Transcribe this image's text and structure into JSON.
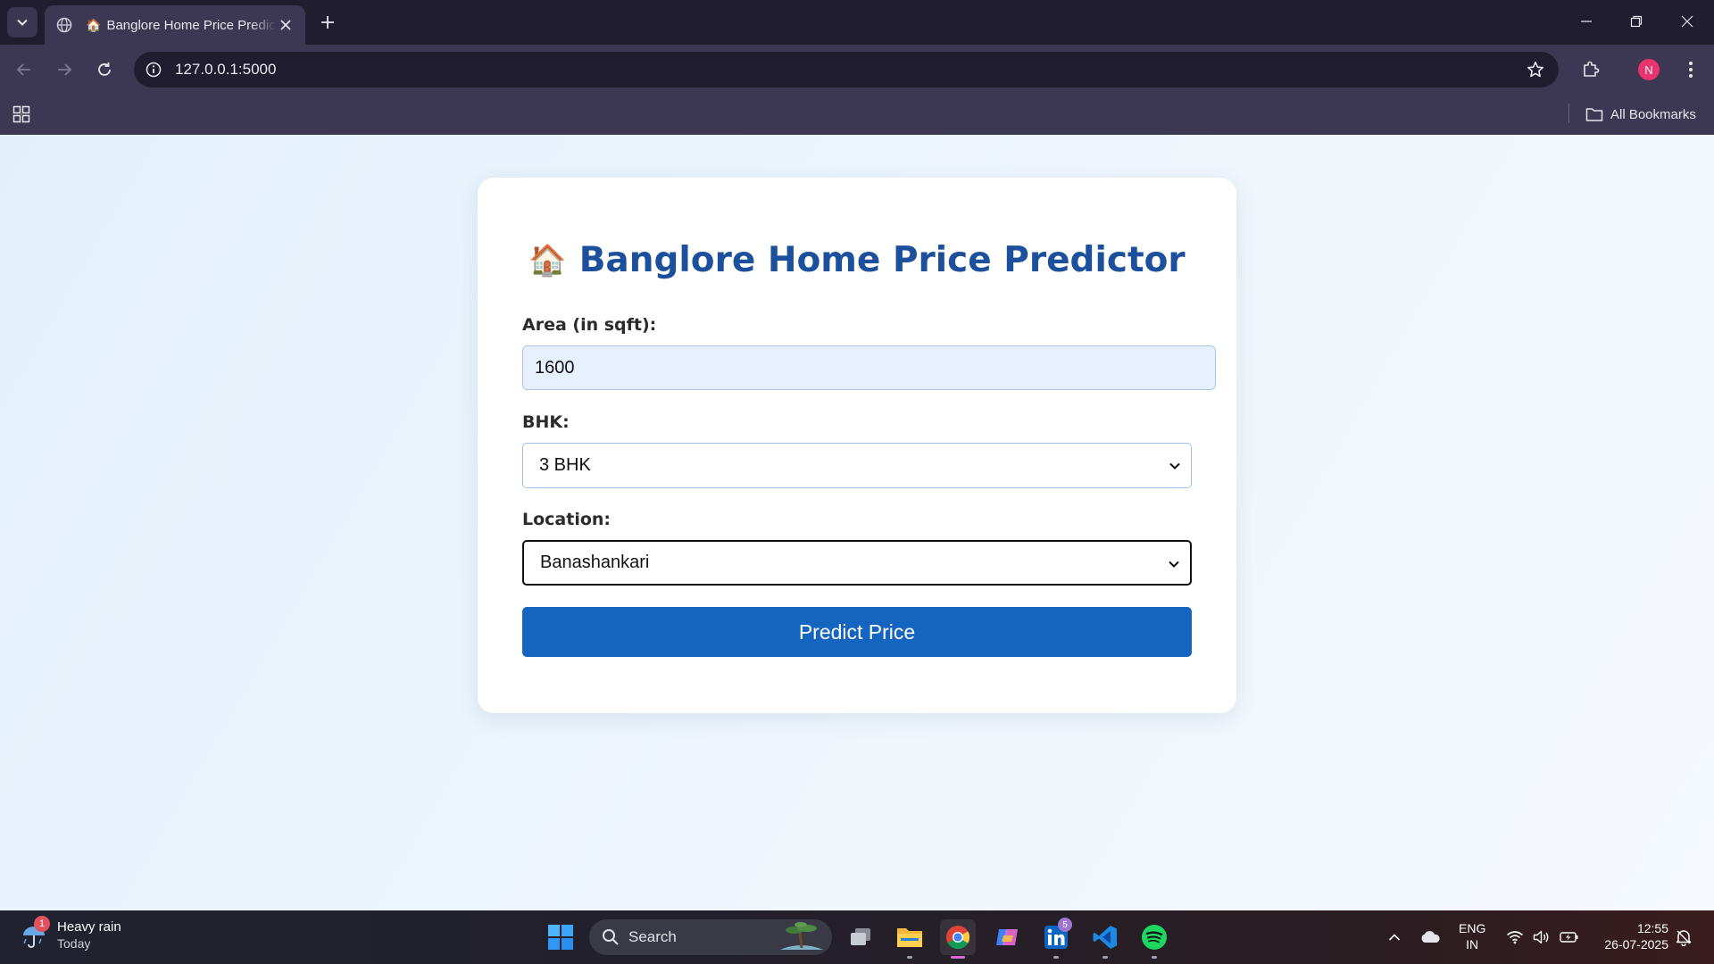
{
  "browser": {
    "tab_title": "Banglore Home Price Predictor",
    "tab_favicon": "🏠",
    "url": "127.0.0.1:5000",
    "profile_initial": "N",
    "all_bookmarks_label": "All Bookmarks",
    "colors": {
      "tabstrip": "#211d31",
      "toolbar": "#3c3753",
      "profile": "#e8336e"
    }
  },
  "page": {
    "title_icon": "🏠",
    "title": "Banglore Home Price Predictor",
    "area_label": "Area (in sqft):",
    "area_value": "1600",
    "bhk_label": "BHK:",
    "bhk_selected": "3 BHK",
    "location_label": "Location:",
    "location_selected": "Banashankari",
    "predict_button": "Predict Price",
    "colors": {
      "title": "#1c4f9c",
      "button": "#1565c0",
      "input_bg": "#e7f0fe"
    }
  },
  "taskbar": {
    "weather_text": "Heavy rain",
    "weather_sub": "Today",
    "weather_badge": "1",
    "search_placeholder": "Search",
    "linkedin_badge": "5",
    "lang_line1": "ENG",
    "lang_line2": "IN",
    "time": "12:55",
    "date": "26-07-2025"
  }
}
